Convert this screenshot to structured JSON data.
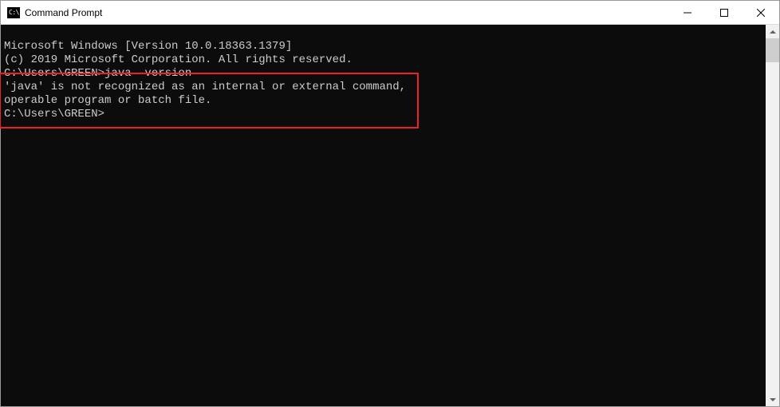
{
  "titlebar": {
    "icon_label": "C:\\.",
    "title": "Command Prompt"
  },
  "terminal": {
    "line1": "Microsoft Windows [Version 10.0.18363.1379]",
    "line2": "(c) 2019 Microsoft Corporation. All rights reserved.",
    "blank1": "",
    "prompt1": "C:\\Users\\GREEN>java -version",
    "error1": "'java' is not recognized as an internal or external command,",
    "error2": "operable program or batch file.",
    "blank2": "",
    "prompt2": "C:\\Users\\GREEN>"
  }
}
